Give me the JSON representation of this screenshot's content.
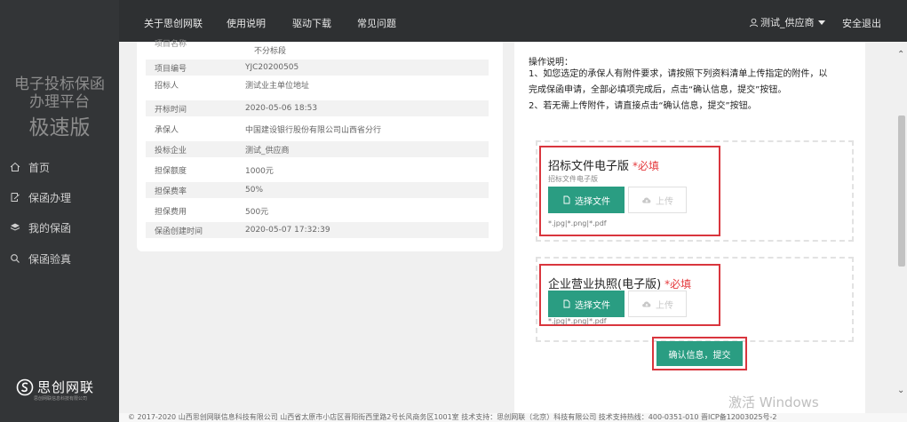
{
  "sidebar": {
    "brand_line1": "电子投标保函",
    "brand_line2": "办理平台",
    "brand_line3": "极速版",
    "items": [
      {
        "label": "首页",
        "icon": "home-icon"
      },
      {
        "label": "保函办理",
        "icon": "edit-icon"
      },
      {
        "label": "我的保函",
        "icon": "layers-icon"
      },
      {
        "label": "保函验真",
        "icon": "search-icon"
      }
    ],
    "logo_text": "思创网联",
    "logo_sub": "思创网联信息科技有限公司"
  },
  "topbar": {
    "links": [
      "关于思创网联",
      "使用说明",
      "驱动下载",
      "常见问题"
    ],
    "user": "测试_供应商",
    "logout": "安全退出"
  },
  "info": {
    "partial_label": "项目名称",
    "partial_value": "不分标段",
    "rows": [
      {
        "k": "项目编号",
        "v": "YJC20200505"
      },
      {
        "k": "招标人",
        "v": "测试业主单位地址"
      },
      {
        "k": "开标时间",
        "v": "2020-05-06 18:53"
      },
      {
        "k": "承保人",
        "v": "中国建设银行股份有限公司山西省分行"
      },
      {
        "k": "投标企业",
        "v": "测试_供应商"
      },
      {
        "k": "担保额度",
        "v": "1000元"
      },
      {
        "k": "担保费率",
        "v": "50%"
      },
      {
        "k": "担保费用",
        "v": "500元"
      },
      {
        "k": "保函创建时间",
        "v": "2020-05-07 17:32:39"
      }
    ]
  },
  "instructions": {
    "title": "操作说明：",
    "line1": "1、如您选定的承保人有附件要求，请按照下列资料清单上传指定的附件，以",
    "line2": "完成保函申请，全部必填项完成后，点击“确认信息，提交”按钮。",
    "line3": "2、若无需上传附件，请直接点击“确认信息，提交”按钮。"
  },
  "uploads": [
    {
      "title": "招标文件电子版",
      "required": "*必填",
      "sub": "招标文件电子版",
      "choose": "选择文件",
      "upload": "上传",
      "hint": "*.jpg|*.png|*.pdf"
    },
    {
      "title": "企业营业执照(电子版)",
      "required": "*必填",
      "sub": "",
      "choose": "选择文件",
      "upload": "上传",
      "hint": "*.jpg|*.png|*.pdf"
    }
  ],
  "submit_label": "确认信息，提交",
  "watermark": "激活 Windows",
  "footer": "© 2017-2020 山西思创网联信息科技有限公司 山西省太原市小店区晋阳街西里路2号长风商务区1001室 技术支持：思创网联（北京）科技有限公司 技术支持热线：400-0351-010 晋ICP备12003025号-2"
}
